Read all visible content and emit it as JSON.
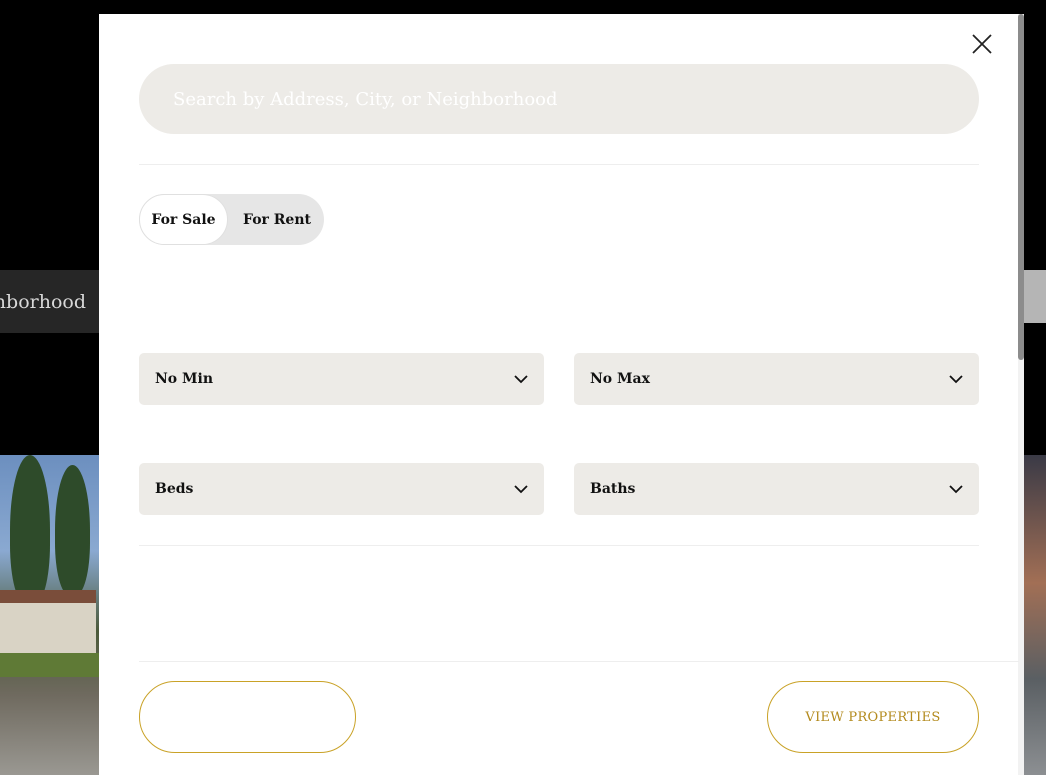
{
  "background": {
    "search_fragment": "hborhood"
  },
  "modal": {
    "search": {
      "placeholder": "Search by Address, City, or Neighborhood",
      "value": ""
    },
    "listing_toggle": {
      "options": [
        "For Sale",
        "For Rent"
      ],
      "selected": "For Sale"
    },
    "filters": {
      "min_price": "No Min",
      "max_price": "No Max",
      "beds": "Beds",
      "baths": "Baths"
    },
    "footer": {
      "reset_label": "",
      "submit_label": "VIEW PROPERTIES"
    },
    "icons": {
      "close": "close-icon",
      "dropdown": "chevron-down-icon"
    }
  },
  "colors": {
    "accent": "#c9a227",
    "field_bg": "#edebe7",
    "toggle_bg": "#e6e6e6",
    "page_bg": "#000000"
  }
}
